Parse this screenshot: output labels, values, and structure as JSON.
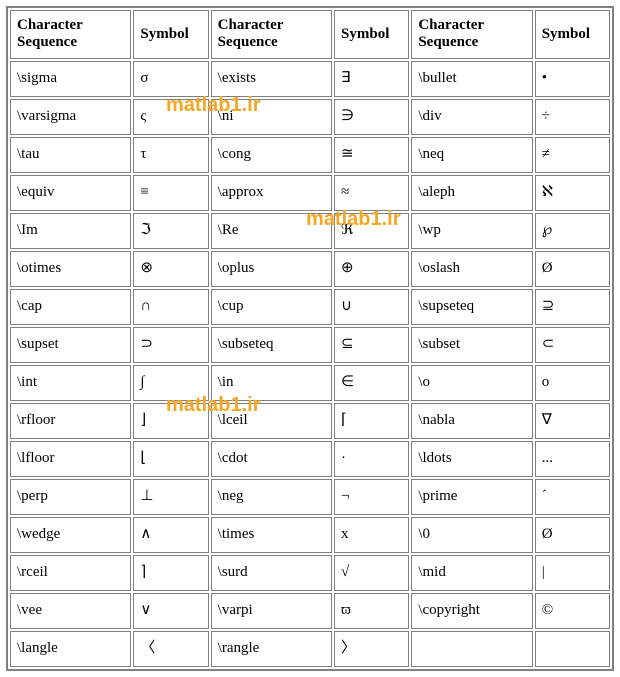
{
  "headers": [
    "Character Sequence",
    "Symbol",
    "Character Sequence",
    "Symbol",
    "Character Sequence",
    "Symbol"
  ],
  "watermark": "matlab1.ir",
  "chart_data": {
    "type": "table",
    "title": "",
    "columns": [
      "Character Sequence",
      "Symbol",
      "Character Sequence",
      "Symbol",
      "Character Sequence",
      "Symbol"
    ],
    "rows": [
      [
        "\\sigma",
        "σ",
        "\\exists",
        "∃",
        "\\bullet",
        "•"
      ],
      [
        "\\varsigma",
        "ς",
        "\\ni",
        "∋",
        "\\div",
        "÷"
      ],
      [
        "\\tau",
        "τ",
        "\\cong",
        "≅",
        "\\neq",
        "≠"
      ],
      [
        "\\equiv",
        "≡",
        "\\approx",
        "≈",
        "\\aleph",
        "ℵ"
      ],
      [
        "\\Im",
        "ℑ",
        "\\Re",
        "ℜ",
        "\\wp",
        "℘"
      ],
      [
        "\\otimes",
        "⊗",
        "\\oplus",
        "⊕",
        "\\oslash",
        "Ø"
      ],
      [
        "\\cap",
        "∩",
        "\\cup",
        "∪",
        "\\supseteq",
        "⊇"
      ],
      [
        "\\supset",
        "⊃",
        "\\subseteq",
        "⊆",
        "\\subset",
        "⊂"
      ],
      [
        "\\int",
        "∫",
        "\\in",
        "∈",
        "\\o",
        "ο"
      ],
      [
        "\\rfloor",
        "⌋",
        "\\lceil",
        "⌈",
        "\\nabla",
        "∇"
      ],
      [
        "\\lfloor",
        "⌊",
        "\\cdot",
        "·",
        "\\ldots",
        "..."
      ],
      [
        "\\perp",
        "⊥",
        "\\neg",
        "¬",
        "\\prime",
        "´"
      ],
      [
        "\\wedge",
        "∧",
        "\\times",
        "x",
        "\\0",
        "Ø"
      ],
      [
        "\\rceil",
        "⌉",
        "\\surd",
        "√",
        "\\mid",
        "|"
      ],
      [
        "\\vee",
        "∨",
        "\\varpi",
        "ϖ",
        "\\copyright",
        "©"
      ],
      [
        "\\langle",
        "〈",
        "\\rangle",
        "〉",
        "",
        ""
      ]
    ]
  }
}
